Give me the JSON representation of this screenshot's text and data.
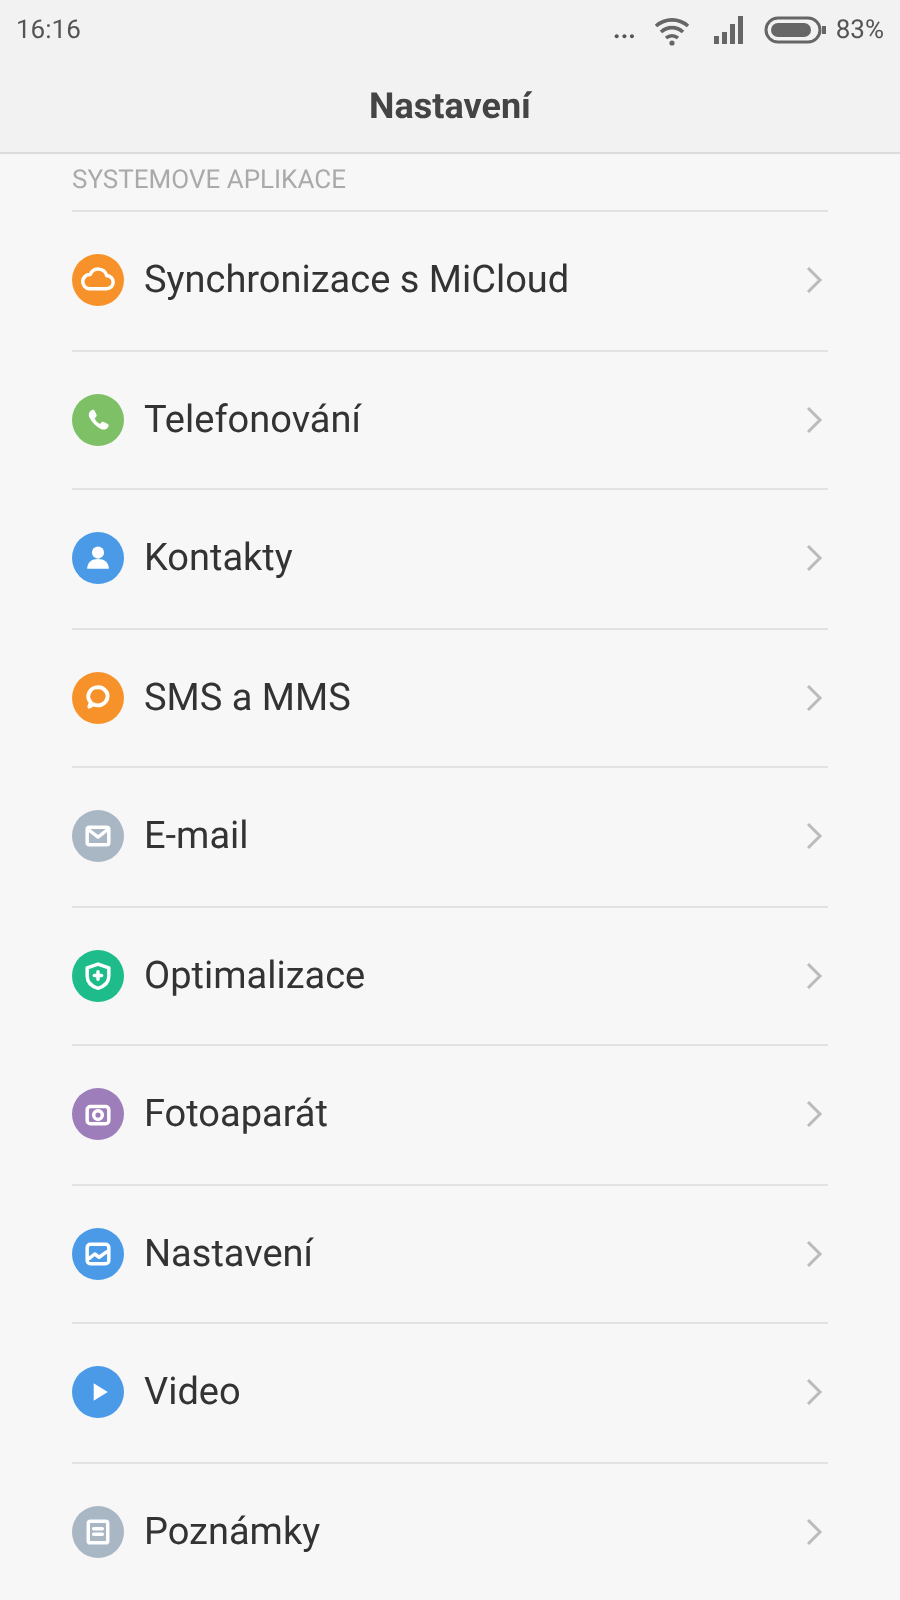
{
  "status_bar": {
    "time": "16:16",
    "more": "...",
    "battery": "83%"
  },
  "header": {
    "title": "Nastavení"
  },
  "section": {
    "title": "SYSTEMOVE APLIKACE"
  },
  "items": [
    {
      "label": "Synchronizace s MiCloud",
      "kind": "cloud",
      "color": "#f7922a"
    },
    {
      "label": "Telefonování",
      "kind": "phone",
      "color": "#7ec065"
    },
    {
      "label": "Kontakty",
      "kind": "person",
      "color": "#4a9ae8"
    },
    {
      "label": "SMS a MMS",
      "kind": "bubble",
      "color": "#f7922a"
    },
    {
      "label": "E-mail",
      "kind": "mail",
      "color": "#a9b6c4"
    },
    {
      "label": "Optimalizace",
      "kind": "shield",
      "color": "#1ebc8a"
    },
    {
      "label": "Fotoaparát",
      "kind": "camera",
      "color": "#9d7dba"
    },
    {
      "label": "Nastavení",
      "kind": "gallery",
      "color": "#4a9ae8"
    },
    {
      "label": "Video",
      "kind": "play",
      "color": "#4a9ae8"
    },
    {
      "label": "Poznámky",
      "kind": "note",
      "color": "#a9b6c4"
    }
  ]
}
